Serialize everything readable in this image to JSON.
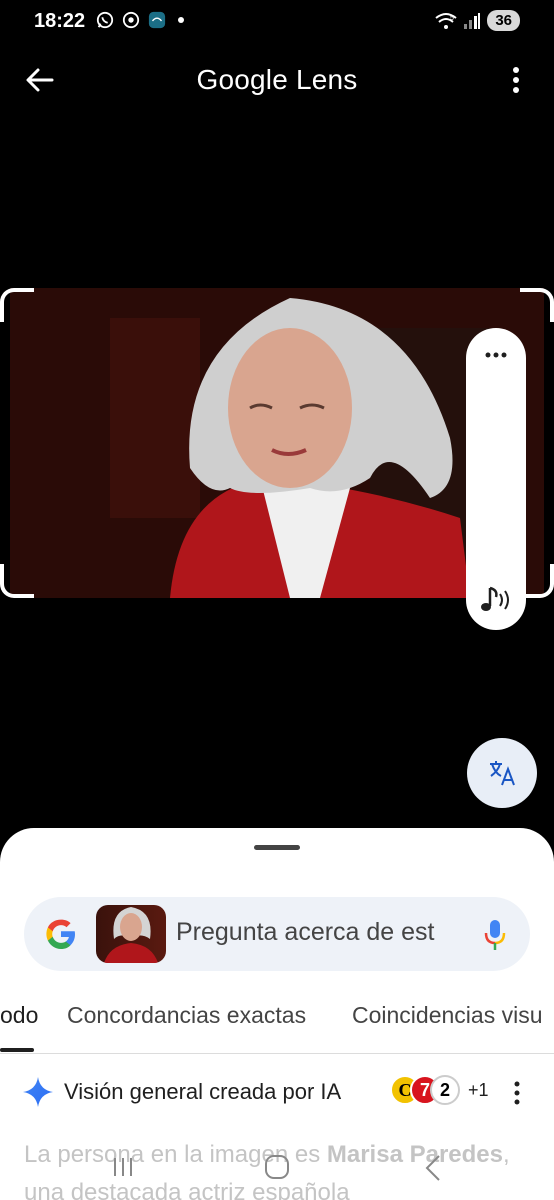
{
  "status_bar": {
    "time": "18:22",
    "battery": "36",
    "network": "5"
  },
  "top_bar": {
    "title": "Google Lens"
  },
  "search": {
    "placeholder": "Pregunta acerca de est"
  },
  "tabs": [
    {
      "label": "Todo",
      "visible_text": "odo",
      "active": true
    },
    {
      "label": "Concordancias exactas",
      "active": false
    },
    {
      "label": "Coincidencias visu",
      "active": false
    }
  ],
  "ai_overview": {
    "title": "Visión general creada por IA",
    "source_count": "+1",
    "text_prefix": "La persona en la imagen es ",
    "text_name": "Marisa Paredes",
    "text_suffix": ", una destacada actriz española"
  },
  "colors": {
    "sheet_bg": "#ffffff",
    "search_bg": "#eef2f8",
    "translate_bg": "#e8eef7",
    "google_blue": "#4285f4",
    "google_red": "#ea4335",
    "google_yellow": "#fbbc05",
    "google_green": "#34a853"
  }
}
